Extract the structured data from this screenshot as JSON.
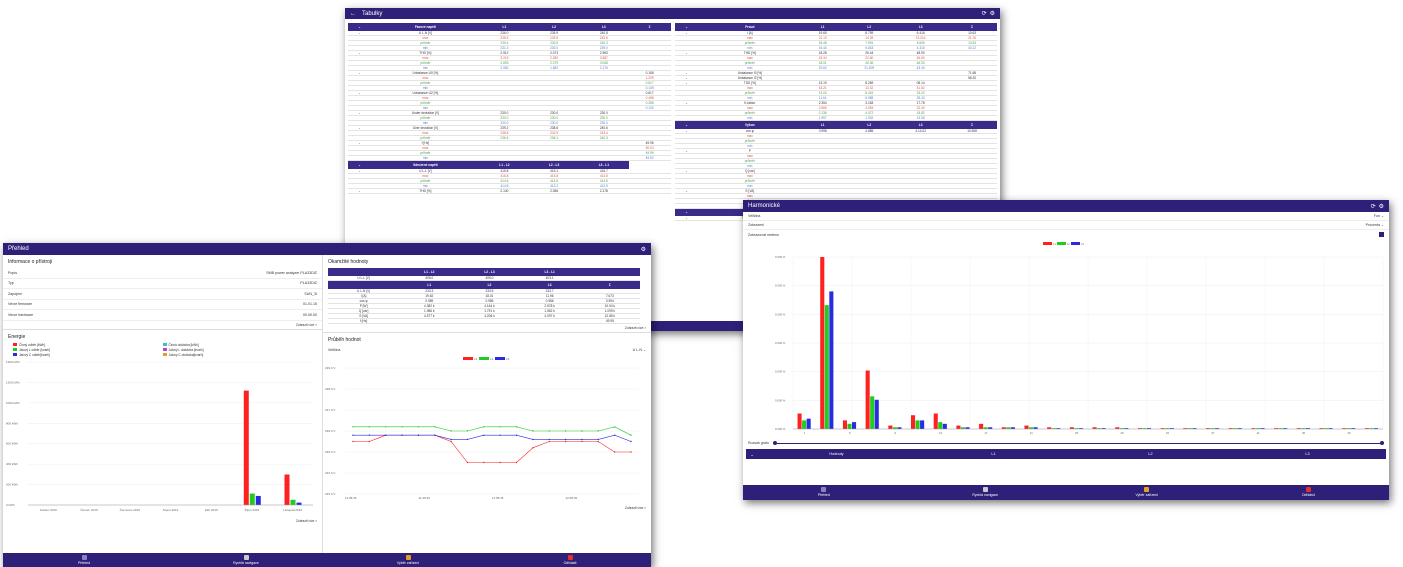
{
  "tabulky": {
    "title": "Tabulky",
    "left_table": {
      "header": [
        "Fázové napětí",
        "L1",
        "L2",
        "L3",
        "Σ"
      ],
      "rows": [
        [
          "U L-N [V]",
          "236.0",
          "235.9",
          "240.8",
          ""
        ],
        [
          "max",
          "238.5",
          "239.5",
          "243.6",
          ""
        ],
        [
          "průměr",
          "235.4",
          "233.5",
          "240.3",
          ""
        ],
        [
          "min",
          "231.3",
          "230.0",
          "239.0",
          ""
        ],
        [
          "THD [%]",
          "2.912",
          "2.073",
          "2.963",
          ""
        ],
        [
          "max",
          "3.215",
          "2.280",
          "3.587",
          ""
        ],
        [
          "průměr",
          "2.693",
          "2.079",
          "3.068",
          ""
        ],
        [
          "min",
          "2.060",
          "1.682",
          "2.176",
          ""
        ],
        [
          "Unbalance U0 [%]",
          "",
          "",
          "",
          "0.168"
        ],
        [
          "max",
          "",
          "",
          "",
          "1.209"
        ],
        [
          "průměr",
          "",
          "",
          "",
          "0.617"
        ],
        [
          "min",
          "",
          "",
          "",
          "0.149"
        ],
        [
          "Unbalance U2 [%]",
          "",
          "",
          "",
          "0.617"
        ],
        [
          "max",
          "",
          "",
          "",
          "0.488"
        ],
        [
          "průměr",
          "",
          "",
          "",
          "0.288"
        ],
        [
          "min",
          "",
          "",
          "",
          "0.130"
        ],
        [
          "Under deviation [V]",
          "230.0",
          "230.0",
          "230.0",
          ""
        ],
        [
          "průměr",
          "230.0",
          "230.0",
          "230.0",
          ""
        ],
        [
          "min",
          "230.0",
          "230.0",
          "230.0",
          ""
        ],
        [
          "Over deviation [V]",
          "239.2",
          "238.6",
          "240.6",
          ""
        ],
        [
          "max",
          "238.8",
          "242.9",
          "243.4",
          ""
        ],
        [
          "průměr",
          "236.5",
          "236.1",
          "240.3",
          ""
        ],
        [
          "f [Hz]",
          "",
          "",
          "",
          "49.96"
        ],
        [
          "max",
          "",
          "",
          "",
          "50.04"
        ],
        [
          "průměr",
          "",
          "",
          "",
          "49.99"
        ],
        [
          "min",
          "",
          "",
          "",
          "49.92"
        ]
      ],
      "header2": [
        "Sdružené napětí",
        "L1 - L2",
        "L2 - L3",
        "L3 - L1"
      ],
      "rows2": [
        [
          "U L-L [V]",
          "415.8",
          "415.1",
          "415.7",
          ""
        ],
        [
          "max",
          "416.8",
          "415.8",
          "414.8",
          ""
        ],
        [
          "průměr",
          "414.6",
          "414.6",
          "414.6",
          ""
        ],
        [
          "min",
          "414.8",
          "413.2",
          "412.9",
          ""
        ],
        [
          "THD [%]",
          "2.140",
          "2.056",
          "2.178",
          ""
        ]
      ]
    },
    "right_table": {
      "header": [
        "Proud",
        "L1",
        "L2",
        "L3",
        "Σ"
      ],
      "rows": [
        [
          "I [A]",
          "19.65",
          "8.759",
          "6.416",
          "10.63"
        ],
        [
          "max",
          "21.10",
          "14.39",
          "13.014",
          "21.76"
        ],
        [
          "průměr",
          "18.48",
          "7.991",
          "5.605",
          "10.63"
        ],
        [
          "min",
          "16.40",
          "6.818",
          "4.315",
          "43.12"
        ],
        [
          "THD [%]",
          "18.28",
          "26.44",
          "48.90",
          ""
        ],
        [
          "max",
          "18.34",
          "22.60",
          "46.60",
          ""
        ],
        [
          "průměr",
          "18.01",
          "26.36",
          "46.30",
          ""
        ],
        [
          "min",
          "15.60",
          "21.609",
          "43.40",
          ""
        ],
        [
          "Unbalance I0 [%]",
          "",
          "",
          "",
          "71.68"
        ],
        [
          "Unbalance I2 [%]",
          "",
          "",
          "",
          "56.20"
        ],
        [
          "TDD [%]",
          "13.19",
          "8.269",
          "08.14",
          ""
        ],
        [
          "max",
          "18.21",
          "13.32",
          "41.62",
          ""
        ],
        [
          "průměr",
          "13.03",
          "8.416",
          "33.02",
          ""
        ],
        [
          "min",
          "11.64",
          "8.985",
          "25.43",
          ""
        ],
        [
          "K-faktor",
          "2.354",
          "3.183",
          "17.78",
          ""
        ],
        [
          "max",
          "2.565",
          "4.054",
          "22.40",
          ""
        ],
        [
          "průměr",
          "2.136",
          "4.072",
          "15.82",
          ""
        ],
        [
          "min",
          "1.997",
          "1.932",
          "13.05",
          ""
        ]
      ],
      "header2": [
        "Výkon",
        "L1",
        "L2",
        "L3",
        "Σ"
      ],
      "rows2": [
        [
          "cos φ",
          "0.998",
          "4.885",
          "4.14.02",
          "10.908"
        ],
        [
          "max",
          "",
          "",
          "",
          ""
        ],
        [
          "průměr",
          "",
          "",
          "",
          ""
        ],
        [
          "min",
          "",
          "",
          "",
          ""
        ],
        [
          "P",
          "",
          "",
          "",
          ""
        ],
        [
          "max",
          "",
          "",
          "",
          ""
        ],
        [
          "průměr",
          "",
          "",
          "",
          ""
        ],
        [
          "min",
          "",
          "",
          "",
          ""
        ],
        [
          "Q [var]",
          "",
          "",
          "",
          ""
        ],
        [
          "max",
          "",
          "",
          "",
          ""
        ],
        [
          "průměr",
          "",
          "",
          "",
          ""
        ],
        [
          "min",
          "",
          "",
          "",
          ""
        ],
        [
          "S [VA]",
          "",
          "",
          "",
          ""
        ],
        [
          "max",
          "",
          "",
          "",
          ""
        ],
        [
          "průměr",
          "",
          "",
          "",
          ""
        ],
        [
          "min",
          "",
          "",
          "",
          ""
        ]
      ],
      "header3": [
        "Jiné"
      ],
      "rows3": [
        [
          "Teplota [°C]",
          "",
          "",
          "",
          ""
        ]
      ]
    }
  },
  "prehled": {
    "title": "Přehled",
    "info_title": "Informace o přístroji",
    "info": [
      [
        "Popis",
        "SMB power analyzer PLA33DIZ"
      ],
      [
        "Typ",
        "PLA33DIZ"
      ],
      [
        "Zapojení",
        "SUN_3I"
      ],
      [
        "Verze firmware",
        "01.01.15"
      ],
      [
        "Verze hardware",
        "00.00.00"
      ]
    ],
    "info_more": "Zobrazit více >",
    "energie_title": "Energie",
    "energie_legend": [
      {
        "label": "Činný odběr [kWh]",
        "color": "#ff2020"
      },
      {
        "label": "Činná dodávka [kWh]",
        "color": "#3ec1c1"
      },
      {
        "label": "Jalový L odběr [kvarh]",
        "color": "#20cc20"
      },
      {
        "label": "Jalový L dodávka [kvarh]",
        "color": "#b04ad0"
      },
      {
        "label": "Jalový C odběr[kvarh]",
        "color": "#2a2ae0"
      },
      {
        "label": "Jalový C dodávka[kvarh]",
        "color": "#e0a020"
      }
    ],
    "energie_more": "Zobrazit více >",
    "okam_title": "Okamžité hodnoty",
    "okam_h1": [
      "",
      "L1 - L2",
      "L2 - L3",
      "L3 - L1",
      ""
    ],
    "okam_r1": [
      "U L-L [V]",
      "405.0",
      "405.0",
      "403.1",
      ""
    ],
    "okam_h2": [
      "",
      "L1",
      "L2",
      "L3",
      "Σ"
    ],
    "okam_rows": [
      [
        "U L-N [V]",
        "233.3",
        "233.5",
        "233.7",
        ""
      ],
      [
        "I [A]",
        "19.62",
        "18.01",
        "11.96",
        "7.673"
      ],
      [
        "cos φ",
        "0.989",
        "0.989",
        "0.986",
        "0.994"
      ],
      [
        "P [W]",
        "4.382 k",
        "4.164 k",
        "2.578 k",
        "10.94 k"
      ],
      [
        "Q [var]",
        "1.986 k",
        "1.791 k",
        "1.562 k",
        "1.099 k"
      ],
      [
        "S [VA]",
        "4.577 k",
        "4.208 k",
        "4.097 k",
        "12.85 k"
      ],
      [
        "f [Hz]",
        "",
        "",
        "",
        "49.95"
      ]
    ],
    "okam_more": "Zobrazit více >",
    "prubeh_title": "Průběh hodnot",
    "prubeh_select_label": "Veličina",
    "prubeh_select_value": "U L-N",
    "prubeh_more": "Zobrazit více >"
  },
  "harmonicke": {
    "title": "Harmonické",
    "rows": [
      {
        "label": "Veličina",
        "value": "Fun"
      },
      {
        "label": "Zobrazení",
        "value": "Procenta"
      },
      {
        "label": "Zobrazovat meteno",
        "value": ""
      }
    ],
    "slider_label": "Rozsah grafu",
    "header": [
      "Hodnoty",
      "L1",
      "L2",
      "L3"
    ]
  },
  "nav": [
    "Přehled",
    "Rychlá navigace",
    "Výběr zařízení",
    "Odhlásit"
  ],
  "colors": {
    "primary": "#2e1f78",
    "L1": "#ff2020",
    "L2": "#20cc20",
    "L3": "#2a2ae0"
  },
  "chart_data": [
    {
      "type": "bar",
      "categories": [
        "Květen 2019",
        "Červen 2019",
        "Červenec 2019",
        "Srpen 2019",
        "Září 2019",
        "Říjen 2019",
        "Listopad 2019"
      ],
      "series": [
        {
          "name": "Činný odběr [kWh]",
          "values": [
            0,
            0,
            0,
            0,
            0,
            1200,
            320
          ]
        },
        {
          "name": "Jalový L odběr [kvarh]",
          "values": [
            0,
            0,
            0,
            0,
            0,
            120,
            55
          ]
        },
        {
          "name": "Jalový C odběr[kvarh]",
          "values": [
            0,
            0,
            0,
            0,
            0,
            95,
            25
          ]
        }
      ],
      "ylim": [
        0,
        1500
      ]
    },
    {
      "type": "line",
      "x_ticks": [
        "11:38:45",
        "11:48:45",
        "11:58:45",
        "12:08:45"
      ],
      "y_ticks": [
        "239.0 V",
        "238.0 V",
        "237.0 V",
        "236.0 V",
        "235.0 V",
        "234.0 V",
        "233.0 V"
      ],
      "series": [
        {
          "name": "L1",
          "values": [
            235.5,
            235.5,
            235.8,
            235.8,
            235.8,
            235.8,
            235.5,
            234.5,
            234.5,
            234.5,
            234.5,
            235.2,
            235.5,
            235.5,
            235.5,
            235.5,
            235.0,
            235.0
          ]
        },
        {
          "name": "L2",
          "values": [
            236.2,
            236.2,
            236.2,
            236.2,
            236.2,
            236.2,
            236.0,
            236.0,
            236.2,
            236.2,
            236.2,
            236.0,
            236.0,
            236.0,
            236.0,
            236.0,
            236.2,
            235.8
          ]
        },
        {
          "name": "L3",
          "values": [
            235.8,
            235.8,
            235.8,
            235.8,
            235.8,
            235.8,
            235.6,
            235.6,
            235.8,
            235.8,
            235.8,
            235.6,
            235.6,
            235.6,
            235.6,
            235.6,
            235.8,
            235.5
          ]
        }
      ]
    },
    {
      "type": "bar",
      "categories": [
        "1",
        "3",
        "5",
        "7",
        "9",
        "11",
        "13",
        "15",
        "17",
        "19",
        "21",
        "23",
        "25",
        "27",
        "29",
        "31",
        "33",
        "35",
        "37",
        "39",
        "41",
        "43",
        "45",
        "47",
        "49",
        "51"
      ],
      "series": [
        {
          "name": "L1",
          "values": [
            9,
            100,
            5,
            34,
            2,
            8,
            9,
            2,
            3,
            1,
            2,
            1,
            1,
            1,
            1,
            0.5,
            0.5,
            0.5,
            0.5,
            0.5,
            0.5,
            0.5,
            0.5,
            0.5,
            0.5,
            0.5
          ]
        },
        {
          "name": "L2",
          "values": [
            5,
            72,
            3,
            19,
            1,
            5,
            4,
            1,
            1,
            1,
            1,
            0.5,
            0.5,
            0.5,
            0.5,
            0.5,
            0.5,
            0.5,
            0.5,
            0.5,
            0.5,
            0.5,
            0.5,
            0.5,
            0.5,
            0.5
          ]
        },
        {
          "name": "L3",
          "values": [
            6,
            80,
            4,
            17,
            1,
            5,
            3,
            1,
            1,
            1,
            1,
            0.5,
            0.5,
            0.5,
            0.5,
            0.5,
            0.5,
            0.5,
            0.5,
            0.5,
            0.5,
            0.5,
            0.5,
            0.5,
            0.5,
            0.5
          ]
        }
      ],
      "y_ticks": [
        "0.000 %",
        "0.000 %",
        "0.000 %",
        "0.000 %",
        "0.000 %",
        "0.000 %",
        "0.000 %"
      ]
    }
  ]
}
